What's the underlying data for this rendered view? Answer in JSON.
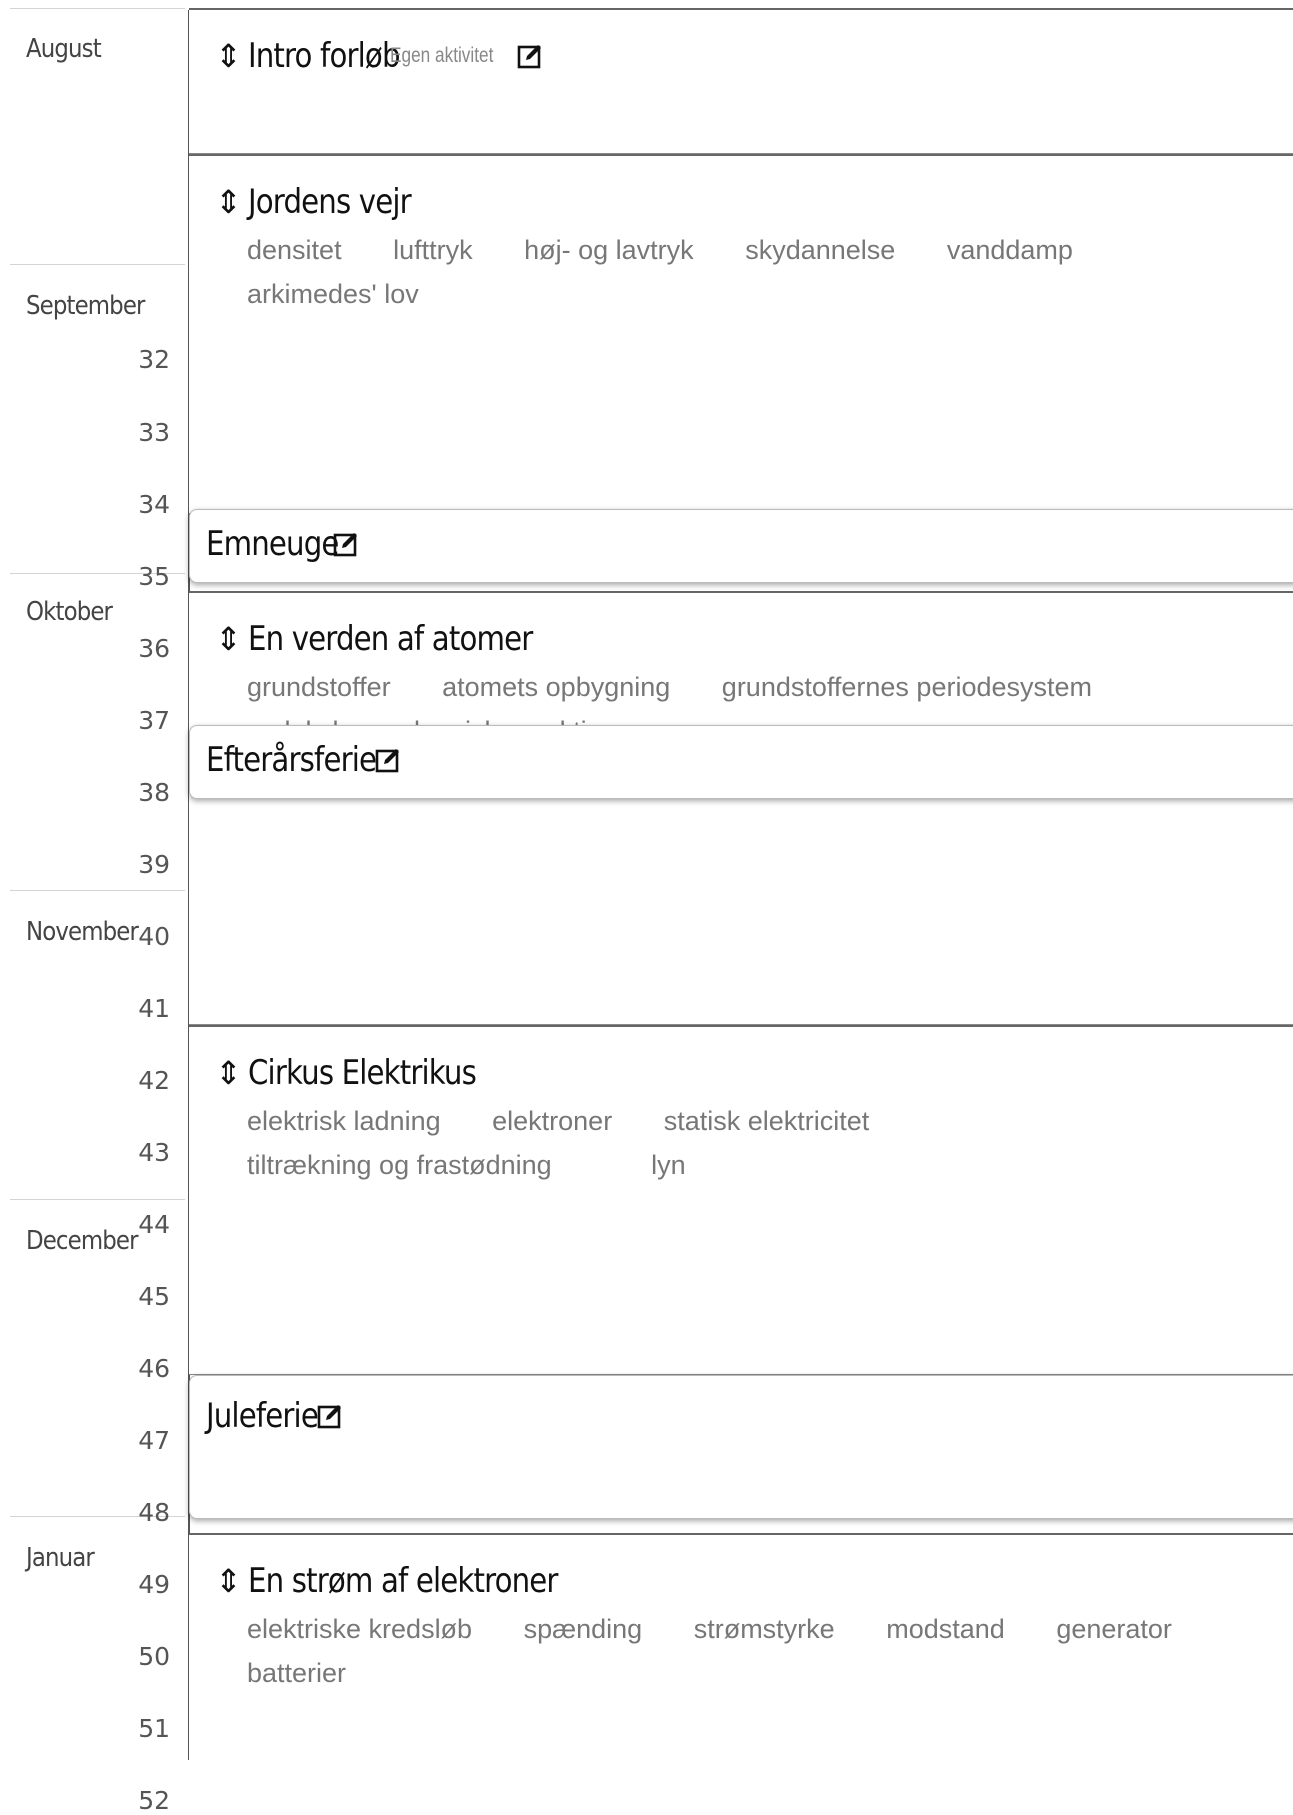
{
  "months": [
    "August",
    "September",
    "Oktober",
    "November",
    "December",
    "Januar"
  ],
  "weeks": [
    "32",
    "33",
    "34",
    "35",
    "36",
    "37",
    "38",
    "39",
    "40",
    "41",
    "42",
    "43",
    "44",
    "45",
    "46",
    "47",
    "48",
    "49",
    "50",
    "51",
    "52"
  ],
  "courses": [
    {
      "title": "Intro forløb",
      "subtitle": "Egen aktivitet",
      "tags": []
    },
    {
      "title": "Jordens vejr",
      "tags": [
        "densitet",
        "lufttryk",
        "høj- og lavtryk",
        "skydannelse",
        "vanddamp",
        "arkimedes' lov"
      ]
    },
    {
      "title": "En verden af atomer",
      "tags": [
        "grundstoffer",
        "atomets opbygning",
        "grundstoffernes periodesystem",
        "molekyler",
        "kemiske reaktioner"
      ]
    },
    {
      "title": "Cirkus Elektrikus",
      "tags": [
        "elektrisk ladning",
        "elektroner",
        "statisk elektricitet",
        "tiltrækning og frastødning",
        "lyn"
      ]
    },
    {
      "title": "En strøm af elektroner",
      "tags": [
        "elektriske kredsløb",
        "spænding",
        "strømstyrke",
        "modstand",
        "generator",
        "batterier"
      ]
    }
  ],
  "breaks": [
    {
      "title": "Emneuge"
    },
    {
      "title": "Efterårsferie"
    },
    {
      "title": "Juleferie"
    }
  ],
  "icons": {
    "move": "updown-arrow-icon",
    "edit": "edit-icon"
  }
}
